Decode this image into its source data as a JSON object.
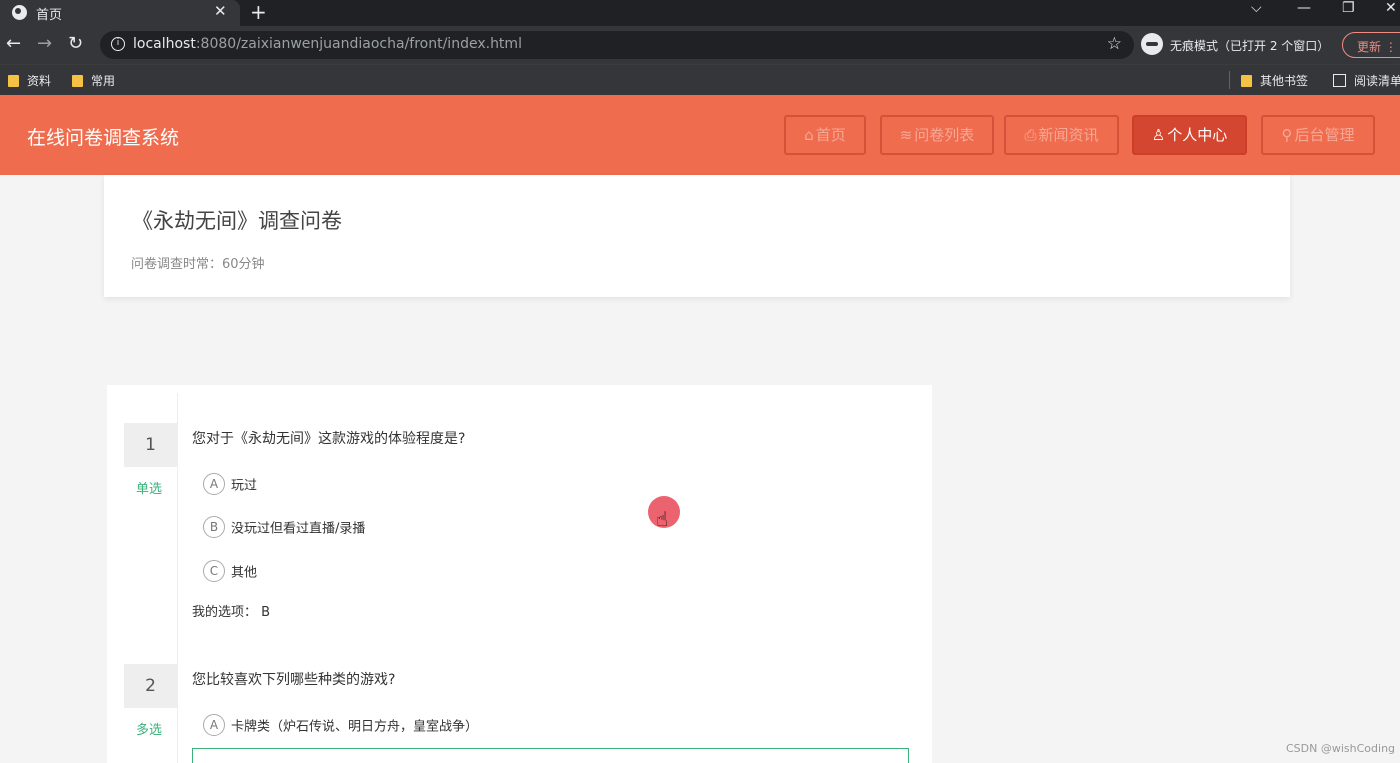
{
  "browser": {
    "tab_title": "首页",
    "url_host": "localhost",
    "url_rest": ":8080/zaixianwenjuandiaocha/front/index.html",
    "incognito_text": "无痕模式（已打开 2 个窗口）",
    "update_label": "更新",
    "bookmarks": [
      "资料",
      "常用"
    ],
    "other_bookmarks": "其他书签",
    "reading_list": "阅读清单"
  },
  "site": {
    "title": "在线问卷调查系统",
    "nav": [
      {
        "label": "首页",
        "icon": "home-icon"
      },
      {
        "label": "问卷列表",
        "icon": "layers-icon"
      },
      {
        "label": "新闻资讯",
        "icon": "printer-icon"
      },
      {
        "label": "个人中心",
        "icon": "user-icon"
      },
      {
        "label": "后台管理",
        "icon": "link-icon"
      }
    ],
    "active_nav": "个人中心"
  },
  "survey": {
    "title": "《永劫无间》调查问卷",
    "time_label": "问卷调查时常：60分钟"
  },
  "questions": [
    {
      "number": "1",
      "type": "单选",
      "text": "您对于《永劫无间》这款游戏的体验程度是?",
      "options": [
        {
          "letter": "A",
          "label": "玩过"
        },
        {
          "letter": "B",
          "label": "没玩过但看过直播/录播"
        },
        {
          "letter": "C",
          "label": "其他"
        }
      ],
      "my_choice": "我的选项：  B"
    },
    {
      "number": "2",
      "type": "多选",
      "text": "您比较喜欢下列哪些种类的游戏?",
      "options": [
        {
          "letter": "A",
          "label": "卡牌类（炉石传说、明日方舟，皇室战争）"
        }
      ]
    }
  ],
  "watermark": "CSDN @wishCoding",
  "colors": {
    "header": "#ef6c4e",
    "active_nav": "#d44630",
    "accent_green": "#3ab27a"
  }
}
